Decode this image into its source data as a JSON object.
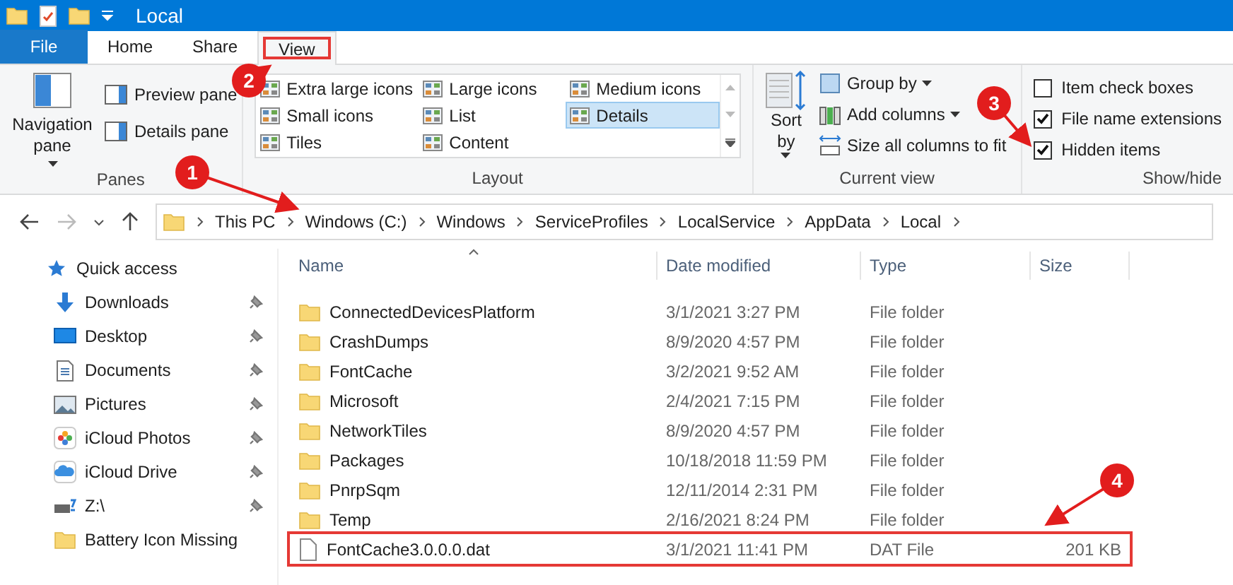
{
  "title_bar": {
    "title": "Local"
  },
  "ribbon_tabs": [
    {
      "label": "File",
      "kind": "file",
      "selected": false
    },
    {
      "label": "Home",
      "kind": "tab",
      "selected": false
    },
    {
      "label": "Share",
      "kind": "tab",
      "selected": false
    },
    {
      "label": "View",
      "kind": "tab",
      "selected": true
    }
  ],
  "panes_group": {
    "label": "Panes",
    "navigation_pane": "Navigation pane",
    "preview_pane": "Preview pane",
    "details_pane": "Details pane"
  },
  "layout_group": {
    "label": "Layout",
    "options": [
      {
        "label": "Extra large icons",
        "selected": false
      },
      {
        "label": "Large icons",
        "selected": false
      },
      {
        "label": "Medium icons",
        "selected": false
      },
      {
        "label": "Small icons",
        "selected": false
      },
      {
        "label": "List",
        "selected": false
      },
      {
        "label": "Details",
        "selected": true
      },
      {
        "label": "Tiles",
        "selected": false
      },
      {
        "label": "Content",
        "selected": false
      }
    ]
  },
  "current_view_group": {
    "label": "Current view",
    "sort_by": "Sort by",
    "commands": [
      {
        "label": "Group by",
        "kind": "group",
        "dropdown": true
      },
      {
        "label": "Add columns",
        "kind": "columns",
        "dropdown": true
      },
      {
        "label": "Size all columns to fit",
        "kind": "fit",
        "dropdown": false
      }
    ]
  },
  "show_hide_group": {
    "label": "Show/hide",
    "options": [
      {
        "label": "Item check boxes",
        "checked": false
      },
      {
        "label": "File name extensions",
        "checked": true
      },
      {
        "label": "Hidden items",
        "checked": true
      }
    ]
  },
  "address_bar": {
    "path": [
      "This PC",
      "Windows (C:)",
      "Windows",
      "ServiceProfiles",
      "LocalService",
      "AppData",
      "Local"
    ]
  },
  "navigation_pane": {
    "items": [
      {
        "label": "Quick access",
        "kind": "star",
        "pinned": false
      },
      {
        "label": "Downloads",
        "kind": "download",
        "pinned": true
      },
      {
        "label": "Desktop",
        "kind": "desktop",
        "pinned": true
      },
      {
        "label": "Documents",
        "kind": "document",
        "pinned": true
      },
      {
        "label": "Pictures",
        "kind": "pictures",
        "pinned": true
      },
      {
        "label": "iCloud Photos",
        "kind": "photos",
        "pinned": true
      },
      {
        "label": "iCloud Drive",
        "kind": "cloud",
        "pinned": true
      },
      {
        "label": "Z:\\",
        "kind": "drive",
        "pinned": true
      },
      {
        "label": "Battery Icon Missing",
        "kind": "folder",
        "pinned": false
      }
    ]
  },
  "file_list": {
    "columns": [
      "Name",
      "Date modified",
      "Type",
      "Size"
    ],
    "rows": [
      {
        "name": "ConnectedDevicesPlatform",
        "date": "3/1/2021 3:27 PM",
        "type": "File folder",
        "kind": "folder",
        "highlighted": false
      },
      {
        "name": "CrashDumps",
        "date": "8/9/2020 4:57 PM",
        "type": "File folder",
        "kind": "folder",
        "highlighted": false
      },
      {
        "name": "FontCache",
        "date": "3/2/2021 9:52 AM",
        "type": "File folder",
        "kind": "folder",
        "highlighted": false
      },
      {
        "name": "Microsoft",
        "date": "2/4/2021 7:15 PM",
        "type": "File folder",
        "kind": "folder",
        "highlighted": false
      },
      {
        "name": "NetworkTiles",
        "date": "8/9/2020 4:57 PM",
        "type": "File folder",
        "kind": "folder",
        "highlighted": false
      },
      {
        "name": "Packages",
        "date": "10/18/2018 11:59 PM",
        "type": "File folder",
        "kind": "folder",
        "highlighted": false
      },
      {
        "name": "PnrpSqm",
        "date": "12/11/2014 2:31 PM",
        "type": "File folder",
        "kind": "folder",
        "highlighted": false
      },
      {
        "name": "Temp",
        "date": "2/16/2021 8:24 PM",
        "type": "File folder",
        "kind": "folder",
        "highlighted": false
      },
      {
        "name": "FontCache3.0.0.0.dat",
        "date": "3/1/2021 11:41 PM",
        "type": "DAT File",
        "size": "201 KB",
        "kind": "file",
        "highlighted": true
      }
    ]
  },
  "callouts": [
    {
      "number": "1"
    },
    {
      "number": "2"
    },
    {
      "number": "3"
    },
    {
      "number": "4"
    }
  ]
}
